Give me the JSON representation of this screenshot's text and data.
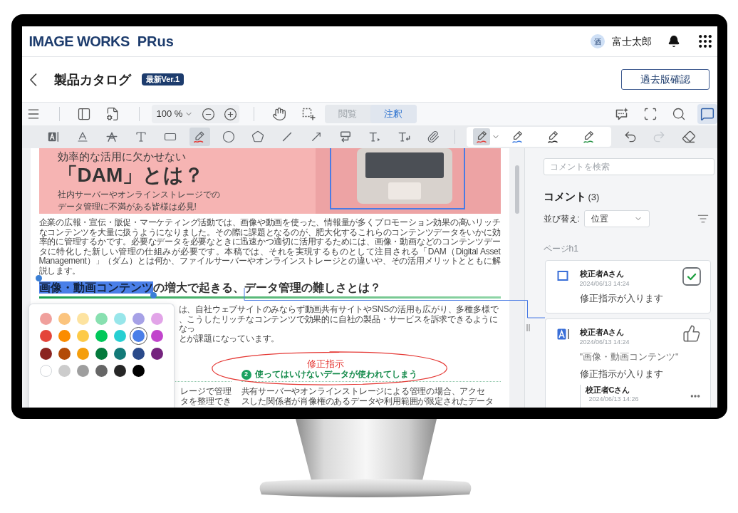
{
  "header": {
    "brand": "IMAGE WORKS",
    "product": "PRus",
    "user_initial": "酒",
    "user_name": "富士太郎"
  },
  "title_bar": {
    "title": "製品カタログ",
    "version": "最新Ver.1",
    "history_button": "過去版確認"
  },
  "toolbar": {
    "zoom": "100 %",
    "modes": [
      {
        "label": "閲覧",
        "selected": false
      },
      {
        "label": "注釈",
        "selected": true
      }
    ],
    "panel_tools": [
      {
        "kind": "comment-sparkle",
        "selected": false
      },
      {
        "kind": "fullscreen",
        "selected": false
      },
      {
        "kind": "search",
        "selected": false
      },
      {
        "kind": "comments",
        "selected": true
      }
    ],
    "annotation_tools": [
      {
        "kind": "text-highlight",
        "selected": false
      },
      {
        "kind": "underline",
        "selected": false
      },
      {
        "kind": "strikethrough",
        "selected": false
      },
      {
        "kind": "text",
        "selected": false
      },
      {
        "kind": "rectangle",
        "selected": false
      },
      {
        "kind": "pen",
        "selected": true
      },
      {
        "kind": "ellipse",
        "selected": false
      },
      {
        "kind": "polygon",
        "selected": false
      },
      {
        "kind": "line",
        "selected": false
      },
      {
        "kind": "arrow",
        "selected": false
      },
      {
        "kind": "callout",
        "selected": false
      },
      {
        "kind": "text-insert",
        "selected": false
      },
      {
        "kind": "text-return",
        "selected": false
      },
      {
        "kind": "attachment",
        "selected": false
      }
    ],
    "pens": [
      {
        "color": "#e53935",
        "selected": true
      },
      {
        "color": "#3b7be0",
        "selected": false
      },
      {
        "color": "#222222",
        "selected": false
      },
      {
        "color": "#1e8e3e",
        "selected": false
      }
    ],
    "edit_actions": [
      {
        "kind": "undo",
        "disabled": false
      },
      {
        "kind": "redo",
        "disabled": true
      },
      {
        "kind": "eraser",
        "disabled": false
      }
    ]
  },
  "document": {
    "banner": {
      "kicker": "効率的な活用に欠かせない",
      "title": "「DAM」とは？",
      "lines": [
        "社内サーバーやオンラインストレージでの",
        "データ管理に不満がある皆様は必見!"
      ]
    },
    "intro": "企業の広報・宣伝・販促・マーケティング活動では、画像や動画を使った、情報量が多くプロモーション効果の高いリッチなコンテンツを大量に扱うようになりました。その際に課題となるのが、肥大化するこれらのコンテンツデータをいかに効率的に管理するかです。必要なデータを必要なときに迅速かつ適切に活用するためには、画像・動画などのコンテンツデータに特化した新しい管理の仕組みが必要です。本稿では、それを実現するものとして注目される「DAM（Digital Asset Management）」（ダム）とは何か、ファイルサーバーやオンラインストレージとの違いや、その活用メリットとともに解説します。",
    "heading": {
      "highlighted": "画像・動画コンテンツ",
      "rest": "の増大で起きる、データ管理の難しさとは？"
    },
    "fragments": [
      "は、自社ウェブサイトのみならず動画共有サイトやSNSの活用も広がり、多種多様で",
      "、こうしたリッチなコンテンツで効果的に自社の製品・サービスを訴求できるようになっ",
      "とが課題になっています。"
    ],
    "column_1_fragments": [
      "レージで管理",
      "タを整理でき"
    ],
    "column_2": {
      "number": "2",
      "heading": "使ってはいけないデータが使われてしまう",
      "lines": [
        "共有サーバーやオンラインストレージによる管理の場合、アクセ",
        "スした関係者が肖像権のあるデータや利用範囲が限定されたデータ"
      ]
    },
    "annotation_note": "修正指示"
  },
  "color_picker": {
    "swatches": [
      {
        "color": "#f0a09c",
        "selected": false
      },
      {
        "color": "#fbc47e",
        "selected": false
      },
      {
        "color": "#fde3a0",
        "selected": false
      },
      {
        "color": "#88e0b0",
        "selected": false
      },
      {
        "color": "#98e6ea",
        "selected": false
      },
      {
        "color": "#a6a1e6",
        "selected": false
      },
      {
        "color": "#e2a4e8",
        "selected": false
      },
      {
        "color": "#e4443a",
        "selected": false
      },
      {
        "color": "#fb8c00",
        "selected": false
      },
      {
        "color": "#fdca47",
        "selected": false
      },
      {
        "color": "#00c85a",
        "selected": false
      },
      {
        "color": "#26cfd2",
        "selected": false
      },
      {
        "color": "#4a7fe8",
        "selected": true
      },
      {
        "color": "#c144cc",
        "selected": false
      },
      {
        "color": "#8b2420",
        "selected": false
      },
      {
        "color": "#b34a06",
        "selected": false
      },
      {
        "color": "#f59e0b",
        "selected": false
      },
      {
        "color": "#047a3c",
        "selected": false
      },
      {
        "color": "#137a78",
        "selected": false
      },
      {
        "color": "#2a4a8a",
        "selected": false
      },
      {
        "color": "#75237e",
        "selected": false
      },
      {
        "color": "#ffffff",
        "selected": false
      },
      {
        "color": "#cccccc",
        "selected": false
      },
      {
        "color": "#9e9e9e",
        "selected": false
      },
      {
        "color": "#666666",
        "selected": false
      },
      {
        "color": "#262626",
        "selected": false
      },
      {
        "color": "#000000",
        "selected": false
      }
    ]
  },
  "comments_panel": {
    "search_placeholder": "コメントを検索",
    "title": "コメント",
    "count": "(3)",
    "sort_label": "並び替え:",
    "sort_value": "位置",
    "page_label": "ページh1",
    "comments": [
      {
        "kind": "rectangle",
        "author": "校正者Aさん",
        "date": "2024/06/13 14:24",
        "body": "修正指示が入ります",
        "action": {
          "kind": "resolve",
          "checked": true
        }
      },
      {
        "kind": "highlight",
        "author": "校正者Aさん",
        "date": "2024/06/13 14:24",
        "quote": "\"画像・動画コンテンツ\"",
        "body": "修正指示が入ります",
        "action": {
          "kind": "like",
          "liked": false
        },
        "replies": [
          {
            "author": "校正者Cさん",
            "date": "2024/06/13 14:26"
          }
        ]
      }
    ]
  }
}
